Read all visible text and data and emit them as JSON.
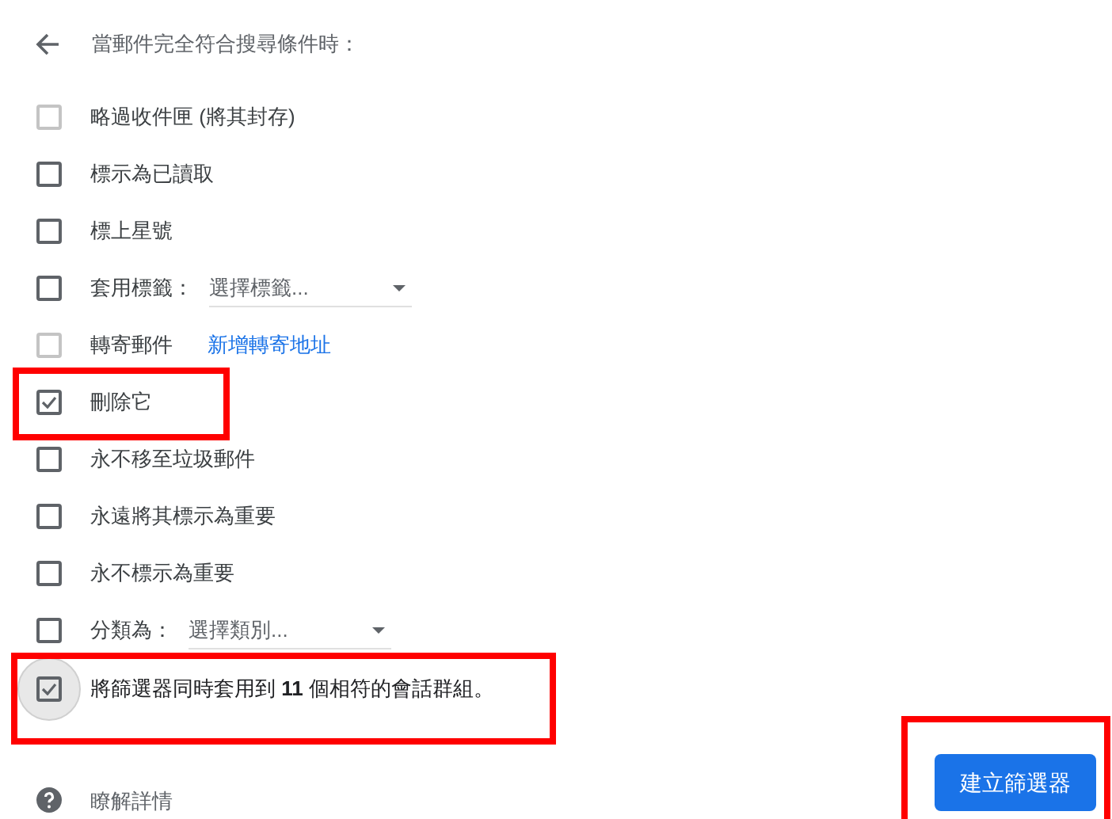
{
  "header": {
    "title": "當郵件完全符合搜尋條件時："
  },
  "options": [
    {
      "kind": "plain",
      "label": "略過收件匣 (將其封存)",
      "checked": false,
      "disabled": true,
      "highlighted": false
    },
    {
      "kind": "plain",
      "label": "標示為已讀取",
      "checked": false,
      "disabled": false,
      "highlighted": false
    },
    {
      "kind": "plain",
      "label": "標上星號",
      "checked": false,
      "disabled": false,
      "highlighted": false
    },
    {
      "kind": "select",
      "label": "套用標籤：",
      "placeholder": "選擇標籤...",
      "checked": false,
      "disabled": false,
      "highlighted": false
    },
    {
      "kind": "link",
      "label": "轉寄郵件",
      "link": "新增轉寄地址",
      "checked": false,
      "disabled": true,
      "highlighted": false
    },
    {
      "kind": "plain",
      "label": "刪除它",
      "checked": true,
      "disabled": false,
      "highlighted": true
    },
    {
      "kind": "plain",
      "label": "永不移至垃圾郵件",
      "checked": false,
      "disabled": false,
      "highlighted": false
    },
    {
      "kind": "plain",
      "label": "永遠將其標示為重要",
      "checked": false,
      "disabled": false,
      "highlighted": false
    },
    {
      "kind": "plain",
      "label": "永不標示為重要",
      "checked": false,
      "disabled": false,
      "highlighted": false
    },
    {
      "kind": "select",
      "label": "分類為：",
      "placeholder": "選擇類別...",
      "checked": false,
      "disabled": false,
      "highlighted": false
    }
  ],
  "apply_existing": {
    "label": "將篩選器同時套用到 **11** 個相符的會話群組。",
    "checked": true,
    "focused": true,
    "highlighted": true
  },
  "footer": {
    "learn_more": "瞭解詳情",
    "create_button": "建立篩選器",
    "create_highlighted": true
  }
}
